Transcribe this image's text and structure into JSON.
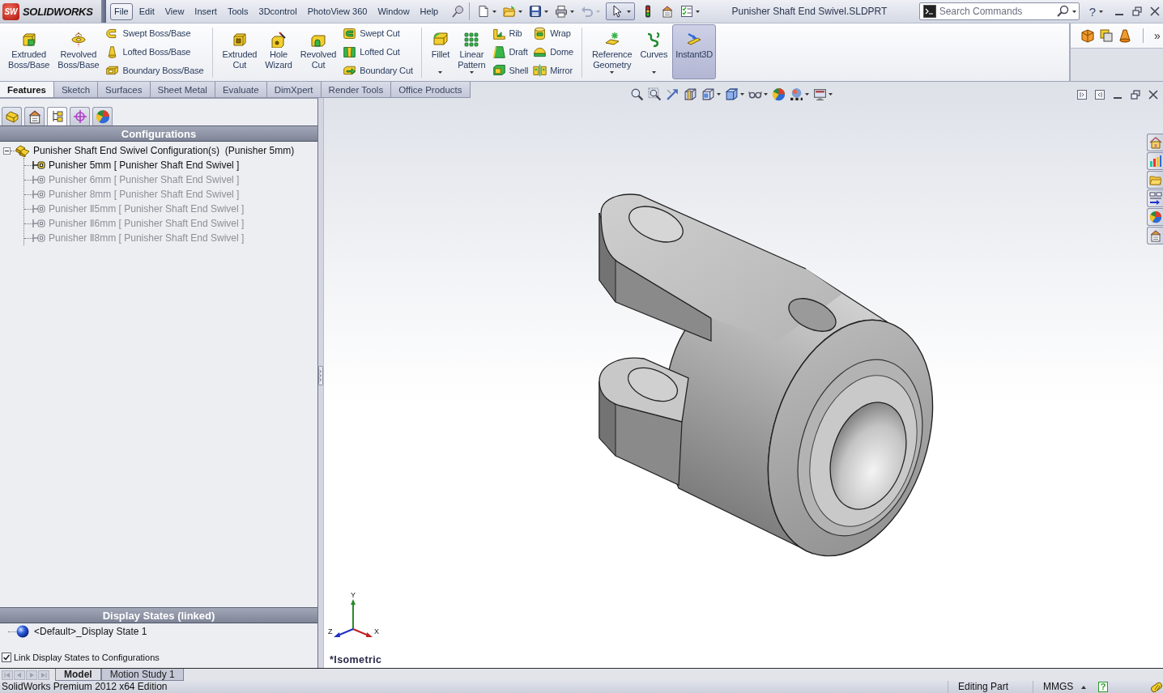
{
  "app": {
    "logo_mark": "SW",
    "logo_name": "SOLIDWORKS"
  },
  "menu": [
    {
      "label": "File",
      "selected": true
    },
    {
      "label": "Edit",
      "selected": false
    },
    {
      "label": "View",
      "selected": false
    },
    {
      "label": "Insert",
      "selected": false
    },
    {
      "label": "Tools",
      "selected": false
    },
    {
      "label": "3Dcontrol",
      "selected": false
    },
    {
      "label": "PhotoView 360",
      "selected": false
    },
    {
      "label": "Window",
      "selected": false
    },
    {
      "label": "Help",
      "selected": false
    }
  ],
  "select_tool": {
    "on": true
  },
  "title": "Punisher Shaft End Swivel.SLDPRT",
  "search": {
    "placeholder": "Search Commands"
  },
  "help_glyph": "?",
  "ribbon": {
    "groups": [
      {
        "items": [
          {
            "kind": "large",
            "label": "Extruded Boss/Base",
            "dropdown": false,
            "on": false
          },
          {
            "kind": "large",
            "label": "Revolved Boss/Base",
            "dropdown": false,
            "on": false
          },
          {
            "kind": "stack",
            "items": [
              {
                "label": "Swept Boss/Base"
              },
              {
                "label": "Lofted Boss/Base"
              },
              {
                "label": "Boundary Boss/Base"
              }
            ]
          }
        ]
      },
      {
        "items": [
          {
            "kind": "large",
            "label": "Extruded Cut",
            "dropdown": false,
            "on": false
          },
          {
            "kind": "large",
            "label": "Hole Wizard",
            "dropdown": false,
            "on": false
          },
          {
            "kind": "large",
            "label": "Revolved Cut",
            "dropdown": false,
            "on": false
          },
          {
            "kind": "stack",
            "items": [
              {
                "label": "Swept Cut"
              },
              {
                "label": "Lofted Cut"
              },
              {
                "label": "Boundary Cut"
              }
            ]
          }
        ]
      },
      {
        "items": [
          {
            "kind": "large",
            "label": "Fillet",
            "dropdown": true,
            "on": false
          },
          {
            "kind": "large",
            "label": "Linear Pattern",
            "dropdown": true,
            "on": false
          },
          {
            "kind": "stack",
            "items": [
              {
                "label": "Rib"
              },
              {
                "label": "Draft"
              },
              {
                "label": "Shell"
              }
            ]
          },
          {
            "kind": "stack",
            "items": [
              {
                "label": "Wrap"
              },
              {
                "label": "Dome"
              },
              {
                "label": "Mirror"
              }
            ]
          }
        ]
      },
      {
        "items": [
          {
            "kind": "large",
            "label": "Reference Geometry",
            "dropdown": true,
            "on": false
          },
          {
            "kind": "large",
            "label": "Curves",
            "dropdown": true,
            "on": false
          },
          {
            "kind": "large",
            "label": "Instant3D",
            "dropdown": false,
            "on": true
          }
        ]
      }
    ],
    "more": "»"
  },
  "tabs": [
    {
      "label": "Features",
      "selected": true
    },
    {
      "label": "Sketch",
      "selected": false
    },
    {
      "label": "Surfaces",
      "selected": false
    },
    {
      "label": "Sheet Metal",
      "selected": false
    },
    {
      "label": "Evaluate",
      "selected": false
    },
    {
      "label": "DimXpert",
      "selected": false
    },
    {
      "label": "Render Tools",
      "selected": false
    },
    {
      "label": "Office Products",
      "selected": false
    }
  ],
  "feature_manager": {
    "tabs": [
      {
        "kind": "features",
        "selected": false
      },
      {
        "kind": "properties",
        "selected": false
      },
      {
        "kind": "configurations",
        "selected": true
      },
      {
        "kind": "dimxpert",
        "selected": false
      },
      {
        "kind": "display",
        "selected": false
      }
    ],
    "configurations": {
      "header": "Configurations",
      "root": {
        "label": "Punisher Shaft End Swivel Configuration(s)  (Punisher 5mm)",
        "expanded": true,
        "children": [
          {
            "label": "Punisher 5mm [ Punisher Shaft End Swivel ]",
            "active": true
          },
          {
            "label": "Punisher 6mm [ Punisher Shaft End Swivel ]",
            "active": false
          },
          {
            "label": "Punisher 8mm [ Punisher Shaft End Swivel ]",
            "active": false
          },
          {
            "label": "Punisher Ⅱ5mm [ Punisher Shaft End Swivel ]",
            "active": false
          },
          {
            "label": "Punisher Ⅱ6mm [ Punisher Shaft End Swivel ]",
            "active": false
          },
          {
            "label": "Punisher Ⅱ8mm [ Punisher Shaft End Swivel ]",
            "active": false
          }
        ]
      }
    },
    "display_states": {
      "header": "Display States (linked)",
      "items": [
        {
          "label": "<Default>_Display State 1"
        }
      ],
      "link_option": {
        "label": "Link Display States to Configurations",
        "checked": true
      }
    }
  },
  "viewport": {
    "triad": {
      "x_label": "X",
      "y_label": "Y",
      "z_label": "Z"
    },
    "view_name": "*Isometric"
  },
  "bottom_tabs": [
    {
      "label": "Model",
      "selected": true
    },
    {
      "label": "Motion Study 1",
      "selected": false
    }
  ],
  "status_bar": {
    "edition": "SolidWorks Premium 2012 x64 Edition",
    "mode": "Editing Part",
    "units": "MMGS",
    "help_glyph": "?"
  }
}
